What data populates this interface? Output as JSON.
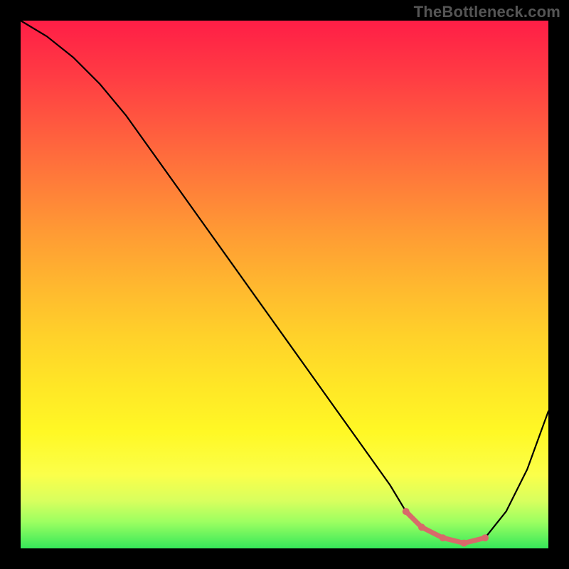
{
  "watermark": "TheBottleneck.com",
  "chart_data": {
    "type": "line",
    "title": "",
    "xlabel": "",
    "ylabel": "",
    "xlim": [
      0,
      100
    ],
    "ylim": [
      0,
      100
    ],
    "series": [
      {
        "name": "bottleneck-curve",
        "x": [
          0,
          5,
          10,
          15,
          20,
          25,
          30,
          35,
          40,
          45,
          50,
          55,
          60,
          65,
          70,
          73,
          76,
          80,
          84,
          88,
          92,
          96,
          100
        ],
        "values": [
          100,
          97,
          93,
          88,
          82,
          75,
          68,
          61,
          54,
          47,
          40,
          33,
          26,
          19,
          12,
          7,
          4,
          2,
          1,
          2,
          7,
          15,
          26
        ]
      },
      {
        "name": "optimal-region",
        "x": [
          73,
          76,
          80,
          84,
          88
        ],
        "values": [
          7,
          4,
          2,
          1,
          2
        ]
      }
    ],
    "colors": {
      "curve": "#000000",
      "optimal_region": "#d86a6a"
    },
    "annotations": []
  }
}
